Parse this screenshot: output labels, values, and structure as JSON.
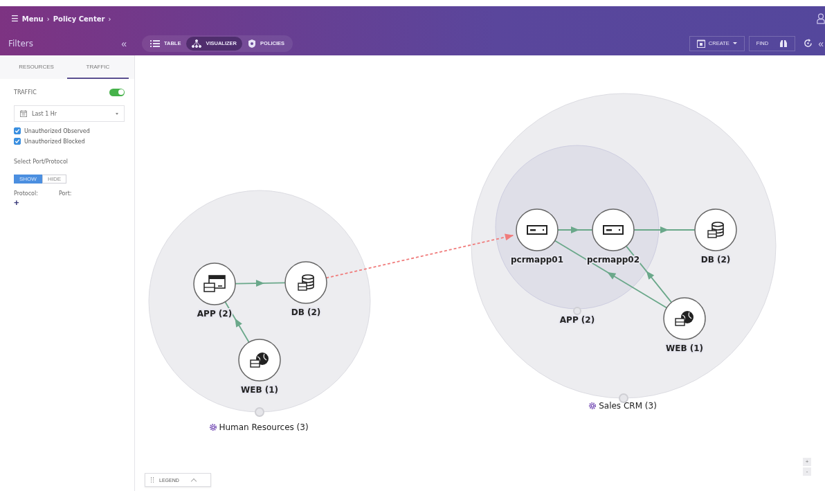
{
  "breadcrumb": {
    "menu_icon": "☰",
    "separator": "›",
    "items": [
      "Menu",
      "Policy Center"
    ]
  },
  "filters_panel": {
    "title": "Filters",
    "collapse": "«"
  },
  "view_tabs": [
    {
      "label": "TABLE",
      "selected": false
    },
    {
      "label": "VISUALIZER",
      "selected": true
    },
    {
      "label": "POLICIES",
      "selected": false
    }
  ],
  "actions": {
    "create": "CREATE",
    "find": "FIND",
    "collapse": "«"
  },
  "sidebar": {
    "tabs": [
      {
        "label": "RESOURCES",
        "selected": false
      },
      {
        "label": "TRAFFIC",
        "selected": true
      }
    ],
    "traffic_toggle": {
      "label": "TRAFFIC",
      "on": true
    },
    "time_range": {
      "value": "Last 1 Hr"
    },
    "checkboxes": [
      {
        "label": "Unauthorized Observed",
        "checked": true
      },
      {
        "label": "Unauthorized Blocked",
        "checked": true
      }
    ],
    "port_section": "Select Port/Protocol",
    "show_hide": [
      {
        "label": "SHOW",
        "selected": true
      },
      {
        "label": "HIDE",
        "selected": false
      }
    ],
    "columns": [
      "Protocol:",
      "Port:"
    ],
    "add": "+"
  },
  "groups": [
    {
      "label": "Human Resources (3)",
      "nodes": [
        {
          "label": "APP (2)",
          "kind": "app"
        },
        {
          "label": "DB (2)",
          "kind": "db"
        },
        {
          "label": "WEB (1)",
          "kind": "web"
        }
      ]
    },
    {
      "label": "Sales CRM (3)",
      "subgroups": [
        {
          "label": "APP (2)",
          "nodes": [
            {
              "label": "pcrmapp01",
              "kind": "server"
            },
            {
              "label": "pcrmapp02",
              "kind": "server"
            }
          ]
        }
      ],
      "nodes": [
        {
          "label": "DB (2)",
          "kind": "db"
        },
        {
          "label": "WEB (1)",
          "kind": "web"
        }
      ]
    }
  ],
  "edges": [
    {
      "kind": "allowed"
    },
    {
      "kind": "allowed"
    },
    {
      "kind": "allowed"
    },
    {
      "kind": "allowed"
    },
    {
      "kind": "allowed"
    },
    {
      "kind": "allowed"
    },
    {
      "kind": "unauthorized"
    }
  ],
  "legend": "LEGEND",
  "zoom": [
    "+",
    "-"
  ]
}
